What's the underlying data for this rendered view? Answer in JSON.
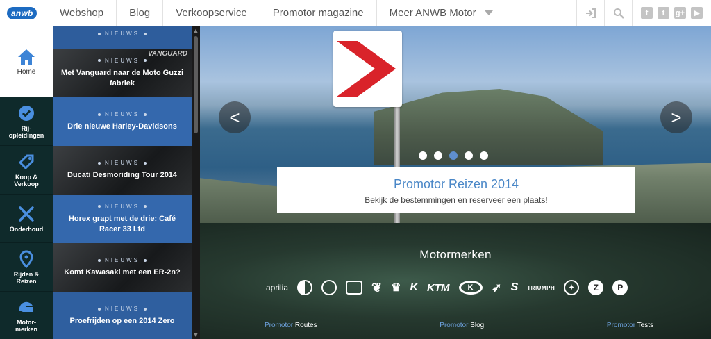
{
  "logo": "anwb",
  "topnav": {
    "items": [
      "Webshop",
      "Blog",
      "Verkoopservice",
      "Promotor magazine",
      "Meer ANWB Motor"
    ]
  },
  "sidebar": {
    "items": [
      {
        "label": "Home",
        "icon": "home-icon"
      },
      {
        "label": "Rij-\nopleidingen",
        "icon": "badge-check-icon"
      },
      {
        "label": "Koop &\nVerkoop",
        "icon": "tag-icon"
      },
      {
        "label": "Onderhoud",
        "icon": "tools-icon"
      },
      {
        "label": "Rijden &\nReizen",
        "icon": "map-pin-icon"
      },
      {
        "label": "Motor-\nmerken",
        "icon": "helmet-icon"
      }
    ]
  },
  "news": {
    "tag": "NIEUWS",
    "items": [
      {
        "title": "Met Vanguard naar de Moto Guzzi fabriek",
        "brand": "VANGUARD"
      },
      {
        "title": "Drie nieuwe Harley-Davidsons"
      },
      {
        "title": "Ducati Desmoriding Tour 2014"
      },
      {
        "title": "Horex grapt met de drie: Café Racer 33 Ltd"
      },
      {
        "title": "Komt Kawasaki met een ER-2n?"
      },
      {
        "title": "Proefrijden op een 2014 Zero"
      }
    ]
  },
  "hero": {
    "title": "Promotor Reizen 2014",
    "subtitle": "Bekijk de bestemmingen en reserveer een plaats!",
    "slide_count": 5,
    "active_slide": 3
  },
  "brands": {
    "title": "Motormerken",
    "items": [
      "aprilia",
      "BMW",
      "DUCATI",
      "HARLEY",
      "HONDA",
      "HUSQVARNA",
      "KAWASAKI",
      "KTM",
      "KYMCO",
      "MOTO GUZZI",
      "SUZUKI",
      "TRIUMPH",
      "YAMAHA",
      "ZERO",
      "PIAGGIO"
    ]
  },
  "footer_links": [
    {
      "prefix": "Promotor",
      "label": "Routes"
    },
    {
      "prefix": "Promotor",
      "label": "Blog"
    },
    {
      "prefix": "Promotor",
      "label": "Tests"
    }
  ],
  "colors": {
    "accent": "#4a87c7",
    "news_blue": "#3468ad",
    "sidebar_bg": "#0f2a2b"
  }
}
